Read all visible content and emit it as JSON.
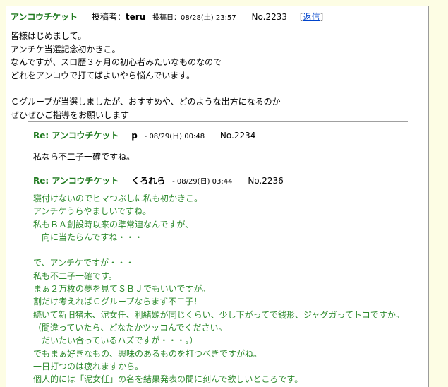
{
  "post": {
    "subject": "アンコウチケット",
    "poster_label": "投稿者：",
    "author": "teru",
    "date": "投稿日：08/28(土) 23:57",
    "number": "No.2233",
    "bracket_open": "[",
    "reply_link": "返信",
    "bracket_close": "]",
    "body": "皆様はじめまして。\nアンチケ当選記念初かきこ。\nなんですが、スロ歴３ヶ月の初心者みたいなものなので\nどれをアンコウで打てばよいやら悩んでいます。\n\nＣグループが当選しましたが、おすすめや、どのような出方になるのか\nぜひぜひご指導をお願いします"
  },
  "replies": [
    {
      "subject": "Re: アンコウチケット",
      "author": "p",
      "date": "- 08/29(日) 00:48",
      "number": "No.2234",
      "body": "私なら不二子一確ですね。"
    },
    {
      "subject": "Re: アンコウチケット",
      "author": "くろれら",
      "date": "- 08/29(日) 03:44",
      "number": "No.2236",
      "body": "寝付けないのでヒマつぶしに私も初かきこ。\nアンチケうらやましいですね。\n私もＢＡ創設時以来の準常連なんですが、\n一向に当たらんですね・・・\n\nで、アンチケですが・・・\n私も不二子一確です。\nまぁ２万枚の夢を見てＳＢＪでもいいですが。\n割だけ考えればＣグループならまず不二子！\n続いて新旧猪木、泥女任、利緒嫄が同じくらい、少し下がってで銭形、ジャグガってトコですか。\n（間違っていたら、どなたかツッコんでください。\n　だいたい合っているハズですが・・・。）\nでもまぁ好きなもの、興味のあるものを打つべきですがね。\n一日打つのは疲れますから。\n個人的には「泥女任」の名を結果発表の間に刻んで欲しいところです。"
    }
  ],
  "colors": {
    "subject_green": "#1f7a1f",
    "reply_body_green": "#2e8b2e",
    "link_blue": "#0044cc",
    "page_bg": "#fdfde4"
  }
}
